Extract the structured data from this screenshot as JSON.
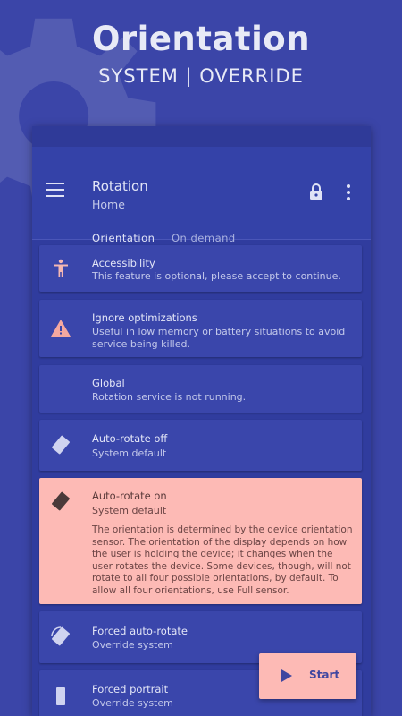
{
  "promo": {
    "title": "Orientation",
    "subtitle": "SYSTEM | OVERRIDE"
  },
  "appbar": {
    "title": "Rotation",
    "subtitle": "Home",
    "icons": [
      "menu-icon",
      "lock-icon",
      "more-vert-icon"
    ]
  },
  "tabs": [
    {
      "label": "Orientation",
      "active": true
    },
    {
      "label": "On demand",
      "active": false
    }
  ],
  "items": [
    {
      "title": "Accessibility",
      "subtitle": "This feature is optional, please accept to continue.",
      "icon": "accessibility-icon"
    },
    {
      "title": "Ignore optimizations",
      "subtitle": "Useful in low memory or battery situations to avoid service being killed.",
      "icon": "warning-icon"
    },
    {
      "title": "Global",
      "subtitle": "Rotation service is not running."
    },
    {
      "title": "Auto-rotate off",
      "subtitle": "System default",
      "icon": "screen-lock-rotation-icon"
    },
    {
      "title": "Auto-rotate on",
      "subtitle": "System default",
      "icon": "screen-rotation-icon",
      "selected": true,
      "description": "The orientation is determined by the device orientation sensor. The orientation of the display depends on how the user is holding the device; it changes when the user rotates the device. Some devices, though, will not rotate to all four possible orientations, by default. To allow all four orientations, use Full sensor."
    },
    {
      "title": "Forced auto-rotate",
      "subtitle": "Override system",
      "icon": "forced-rotation-icon"
    },
    {
      "title": "Forced portrait",
      "subtitle": "Override system",
      "icon": "portrait-icon"
    }
  ],
  "fab": {
    "label": "Start",
    "icon": "play-icon"
  },
  "colors": {
    "background": "#3b45a8",
    "card": "#3a46ab",
    "accent": "#fdbab5",
    "warning": "#f4a8a0"
  }
}
